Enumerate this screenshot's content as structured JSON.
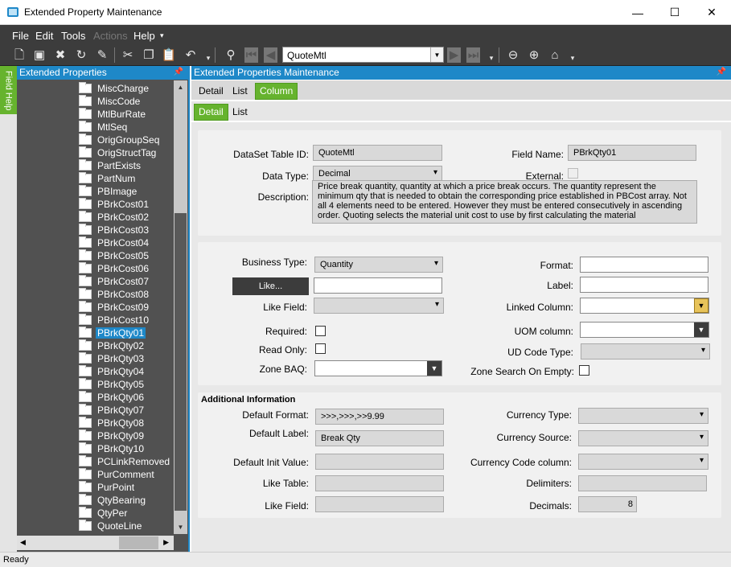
{
  "window": {
    "title": "Extended Property Maintenance",
    "min": "—",
    "max": "☐",
    "close": "✕"
  },
  "menu": [
    {
      "label": "File",
      "enabled": true
    },
    {
      "label": "Edit",
      "enabled": true
    },
    {
      "label": "Tools",
      "enabled": true
    },
    {
      "label": "Actions",
      "enabled": false
    },
    {
      "label": "Help",
      "enabled": true
    }
  ],
  "toolbar": {
    "record_combo_value": "QuoteMtl"
  },
  "field_help": {
    "label": "Field Help"
  },
  "left_panel": {
    "title": "Extended Properties",
    "selected": "PBrkQty01",
    "items": [
      "MiscCharge",
      "MiscCode",
      "MtlBurRate",
      "MtlSeq",
      "OrigGroupSeq",
      "OrigStructTag",
      "PartExists",
      "PartNum",
      "PBImage",
      "PBrkCost01",
      "PBrkCost02",
      "PBrkCost03",
      "PBrkCost04",
      "PBrkCost05",
      "PBrkCost06",
      "PBrkCost07",
      "PBrkCost08",
      "PBrkCost09",
      "PBrkCost10",
      "PBrkQty01",
      "PBrkQty02",
      "PBrkQty03",
      "PBrkQty04",
      "PBrkQty05",
      "PBrkQty06",
      "PBrkQty07",
      "PBrkQty08",
      "PBrkQty09",
      "PBrkQty10",
      "PCLinkRemoved",
      "PurComment",
      "PurPoint",
      "QtyBearing",
      "QtyPer",
      "QuoteLine"
    ]
  },
  "right_panel": {
    "title": "Extended Properties Maintenance",
    "tabs": [
      "Detail",
      "List",
      "Column"
    ],
    "active_tab": "Column",
    "subtabs": [
      "Detail",
      "List"
    ],
    "active_subtab": "Detail"
  },
  "form": {
    "dataset_table_id": {
      "label": "DataSet Table ID:",
      "value": "QuoteMtl"
    },
    "field_name": {
      "label": "Field Name:",
      "value": "PBrkQty01"
    },
    "data_type": {
      "label": "Data Type:",
      "value": "Decimal"
    },
    "external": {
      "label": "External:",
      "checked": false
    },
    "description": {
      "label": "Description:",
      "value": "Price break quantity, quantity at which a price break occurs. The quantity represent the minimum qty that is needed to obtain the corresponding price established in PBCost array. Not all 4 elements need to be entered. However they must be entered consecutively in ascending order. Quoting selects the material unit cost to use by first calculating the material"
    },
    "business_type": {
      "label": "Business Type:",
      "value": "Quantity"
    },
    "like_button": "Like...",
    "like_field": {
      "label": "Like Field:",
      "value": ""
    },
    "required": {
      "label": "Required:",
      "checked": false
    },
    "read_only": {
      "label": "Read Only:",
      "checked": false
    },
    "zone_baq": {
      "label": "Zone BAQ:",
      "value": ""
    },
    "format": {
      "label": "Format:",
      "value": ""
    },
    "field_label": {
      "label": "Label:",
      "value": ""
    },
    "linked_column": {
      "label": "Linked Column:",
      "value": ""
    },
    "uom_column": {
      "label": "UOM column:",
      "value": ""
    },
    "ud_code_type": {
      "label": "UD Code Type:",
      "value": ""
    },
    "zone_search_on_empty": {
      "label": "Zone Search On Empty:",
      "checked": false
    }
  },
  "additional": {
    "heading": "Additional Information",
    "default_format": {
      "label": "Default Format:",
      "value": ">>>,>>>,>>9.99"
    },
    "default_label": {
      "label": "Default Label:",
      "value": "Break Qty"
    },
    "default_init_value": {
      "label": "Default Init Value:",
      "value": ""
    },
    "like_table": {
      "label": "Like Table:",
      "value": ""
    },
    "like_field": {
      "label": "Like Field:",
      "value": ""
    },
    "currency_type": {
      "label": "Currency Type:",
      "value": ""
    },
    "currency_source": {
      "label": "Currency Source:",
      "value": ""
    },
    "currency_code_column": {
      "label": "Currency Code column:",
      "value": ""
    },
    "delimiters": {
      "label": "Delimiters:",
      "value": ""
    },
    "decimals": {
      "label": "Decimals:",
      "value": "8"
    }
  },
  "status": {
    "text": "Ready"
  }
}
